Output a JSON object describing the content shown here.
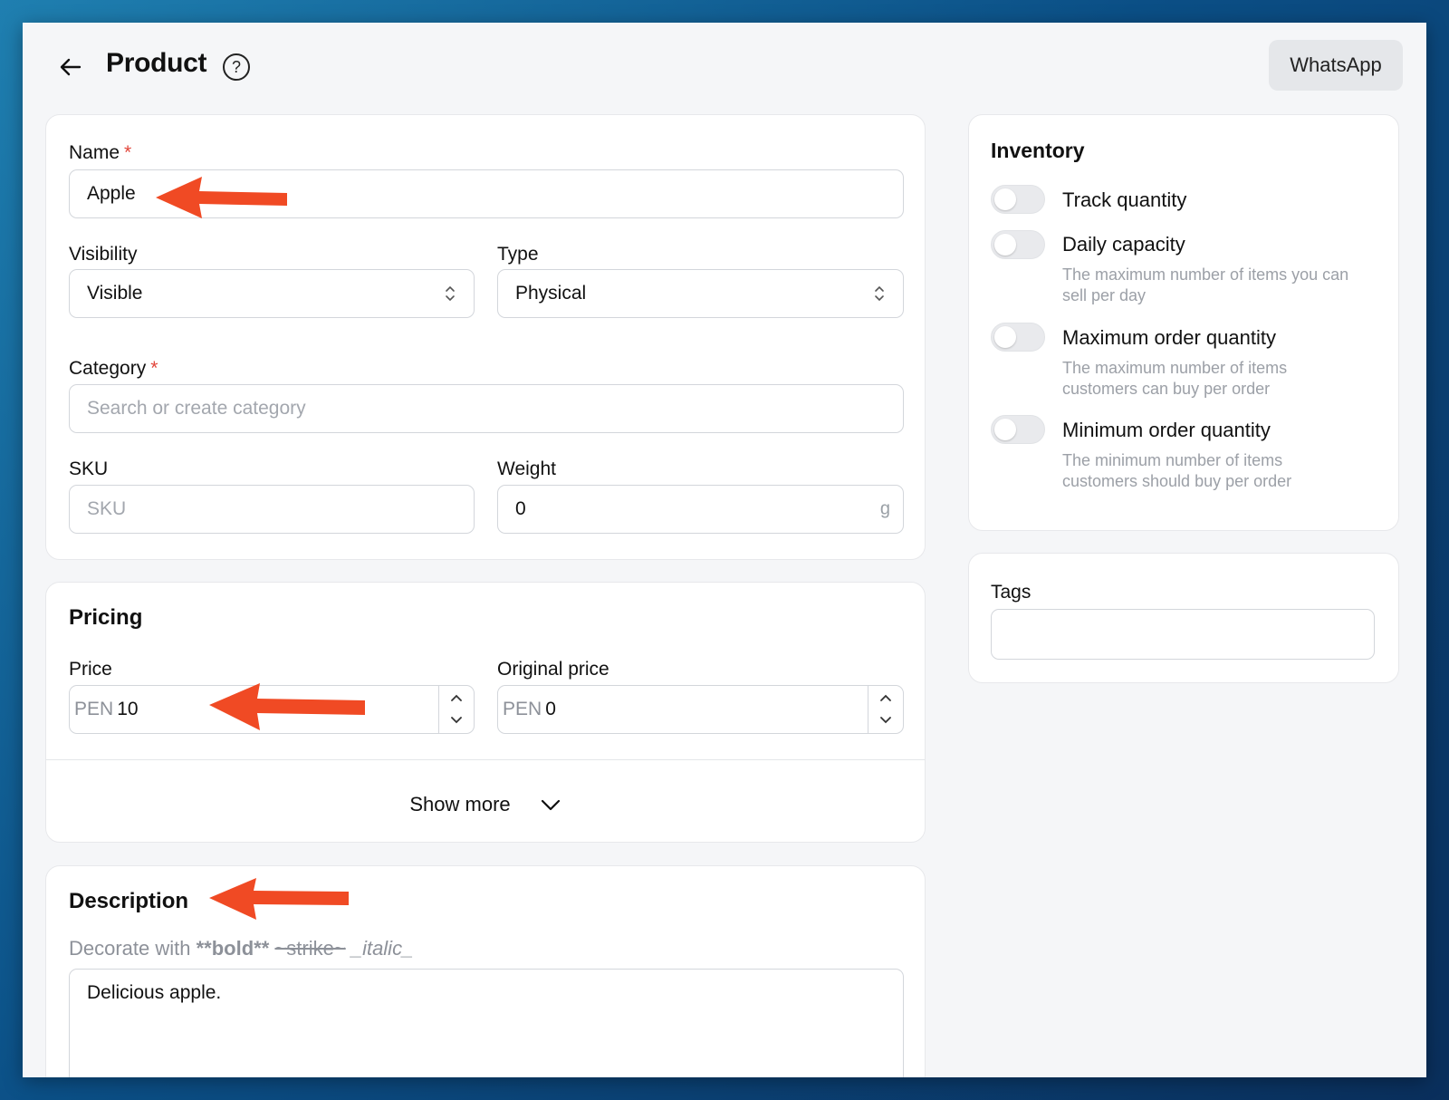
{
  "header": {
    "back_icon": "arrow-left-icon",
    "title": "Product",
    "help_icon": "question-circle-icon",
    "help_glyph": "?",
    "whatsapp_label": "WhatsApp"
  },
  "general": {
    "name_label": "Name",
    "name_required": "*",
    "name_value": "Apple",
    "visibility_label": "Visibility",
    "visibility_value": "Visible",
    "type_label": "Type",
    "type_value": "Physical",
    "category_label": "Category",
    "category_required": "*",
    "category_placeholder": "Search or create category",
    "sku_label": "SKU",
    "sku_placeholder": "SKU",
    "weight_label": "Weight",
    "weight_value": "0",
    "weight_unit": "g"
  },
  "pricing": {
    "title": "Pricing",
    "price_label": "Price",
    "price_prefix": "PEN",
    "price_value": "10",
    "original_price_label": "Original price",
    "original_price_prefix": "PEN",
    "original_price_value": "0",
    "show_more_label": "Show more"
  },
  "description": {
    "title": "Description",
    "hint_prefix": "Decorate with ",
    "hint_bold": "**bold**",
    "hint_strike": "~strike~",
    "hint_italic": "_italic_",
    "value": "Delicious apple."
  },
  "inventory": {
    "title": "Inventory",
    "items": [
      {
        "label": "Track quantity",
        "desc": "",
        "enabled": false
      },
      {
        "label": "Daily capacity",
        "desc": "The maximum number of items you can sell per day",
        "enabled": false
      },
      {
        "label": "Maximum order quantity",
        "desc": "The maximum number of items customers can buy per order",
        "enabled": false
      },
      {
        "label": "Minimum order quantity",
        "desc": "The minimum number of items customers should buy per order",
        "enabled": false
      }
    ]
  },
  "tags": {
    "label": "Tags",
    "value": ""
  },
  "annotations": {
    "arrow_color": "#f04a24"
  }
}
